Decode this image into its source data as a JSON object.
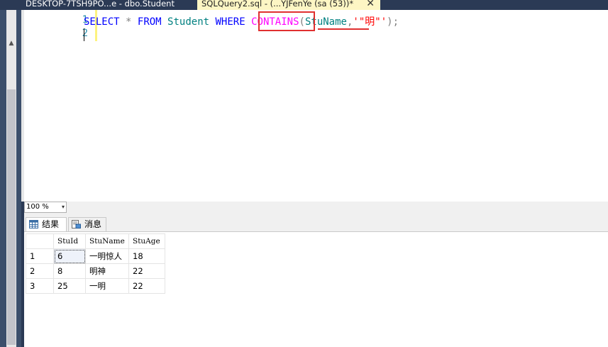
{
  "tabs": {
    "inactive_label": "DESKTOP-7TSH9PO...e - dbo.Student",
    "active_label": "SQLQuery2.sql - (...YJFenYe (sa (53))*",
    "close_glyph": "✕"
  },
  "editor": {
    "line_numbers": [
      "1",
      "2"
    ],
    "tokens": {
      "select": "SELECT",
      "star": "*",
      "from": "FROM",
      "table": "Student",
      "where": "WHERE",
      "contains": "CONTAINS",
      "open_paren": "(",
      "column": "StuName",
      "comma": ",",
      "literal": "'\"明\"'",
      "close": ");"
    }
  },
  "zoom": {
    "value": "100 %",
    "arrow": "▾"
  },
  "results_tabs": {
    "results": "结果",
    "messages": "消息"
  },
  "grid": {
    "columns": [
      "StuId",
      "StuName",
      "StuAge"
    ],
    "rows": [
      {
        "num": "1",
        "StuId": "6",
        "StuName": "一明惊人",
        "StuAge": "18"
      },
      {
        "num": "2",
        "StuId": "8",
        "StuName": "明神",
        "StuAge": "22"
      },
      {
        "num": "3",
        "StuId": "25",
        "StuName": "一明",
        "StuAge": "22"
      }
    ]
  },
  "colors": {
    "keyword": "#0000ff",
    "function": "#ff00ff",
    "string": "#ff0000",
    "identifier": "#008080",
    "annotation": "#e03030",
    "active_tab": "#fdf6c4"
  },
  "icons": {
    "tab_close": "close-icon",
    "results_tab": "grid-icon",
    "messages_tab": "message-icon",
    "scroll_up": "scroll-up-arrow-icon"
  }
}
